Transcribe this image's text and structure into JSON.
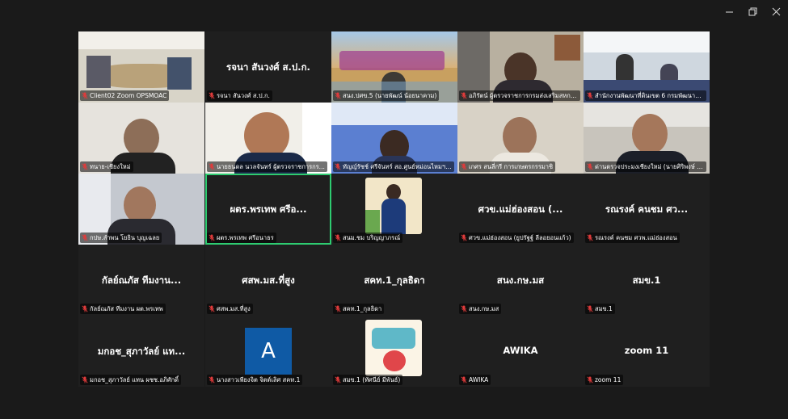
{
  "window_controls": {
    "minimize": "—",
    "restore": "❐",
    "close": "✕"
  },
  "participants": [
    {
      "label": "Client02 Zoom OPSMOAC",
      "video": true,
      "scene": "meeting-room"
    },
    {
      "label": "รจนา สันวงศ์ ส.ป.ก.",
      "name": "รจนา สันวงศ์ ส.ป.ก.",
      "video": false
    },
    {
      "label": "สนง.ปศข.5 (นายพัฒน์ น้อยนาคาม)",
      "video": true,
      "scene": "banner"
    },
    {
      "label": "อภิรัตน์ ผู้ตรวจราชการกรมส่งเสริมสหกรณ์",
      "video": true,
      "scene": "office-woman"
    },
    {
      "label": "สำนักงานพัฒนาที่ดินเขต 6 กรมพัฒนาที่ดิน",
      "video": true,
      "scene": "office-room"
    },
    {
      "label": "ทนาย-เชียงใหม่",
      "video": true,
      "scene": "man-glasses"
    },
    {
      "label": "นายธนดล นวลจันทร์ ผู้ตรวจราชการกร...",
      "video": true,
      "scene": "man-screen",
      "active": true
    },
    {
      "label": "ทัญญ์รัชช์ ศรีจันทร์ สอ.ศูนย์หม่อนไหมฯ เชี...",
      "video": true,
      "scene": "woman-banner"
    },
    {
      "label": "เกศร สนลี่กรี การเกษตรกรรมาชิ",
      "video": true,
      "scene": "man-white"
    },
    {
      "label": "ด่านตรวจประมงเชียงใหม่ (นายศิริพงษ์ สารกั...",
      "video": true,
      "scene": "man-uniform"
    },
    {
      "label": "กปษ.ลำพน โยธิน บุญเฉลย",
      "video": true,
      "scene": "man-suit"
    },
    {
      "label": "ผตร.พรเทพ ศรีอนาธร",
      "name": "ผตร.พรเทพ ศรีอ...",
      "video": false,
      "active": true
    },
    {
      "label": "สนม.ชม บริญญาภรณ์",
      "video": false,
      "thumb": "woman-photo"
    },
    {
      "label": "ศวข.แม่ฮ่องสอน (ยูปรัฐฐ์ ลีลอยอนแก้ว)",
      "name": "ศวข.แม่ฮ่องสอน (...",
      "video": false
    },
    {
      "label": "รณรงค์ คนชม ศวพ.แม่ฮ่องสอน",
      "name": "รณรงค์ คนชม ศว...",
      "video": false
    },
    {
      "label": "กัลย์ณภัส ทีมงาน ผต.พรเทพ",
      "name": "กัลย์ณภัส ทีมงาน...",
      "video": false
    },
    {
      "label": "ศสพ.มส.ที่สูง",
      "name": "ศสพ.มส.ที่สูง",
      "video": false
    },
    {
      "label": "สคท.1_กุลธิดา",
      "name": "สคท.1_กุลธิดา",
      "video": false
    },
    {
      "label": "สนง.กษ.มส",
      "name": "สนง.กษ.มส",
      "video": false
    },
    {
      "label": "สมข.1",
      "name": "สมข.1",
      "video": false
    },
    {
      "label": "มกอช_สุภาวัลย์ แทน ผชช.อภิศักดิ์",
      "name": "มกอช_สุภาวัลย์ แท...",
      "video": false
    },
    {
      "label": "นางสาวเพียงจิต จิตต์เลิศ สคท.1",
      "video": false,
      "avatar": "A"
    },
    {
      "label": "สมข.1 (ทัศนีย์ มีพันธ์)",
      "video": false,
      "thumb": "logo-card"
    },
    {
      "label": "AWIKA",
      "name": "AWIKA",
      "video": false
    },
    {
      "label": "zoom 11",
      "name": "zoom 11",
      "video": false
    }
  ]
}
